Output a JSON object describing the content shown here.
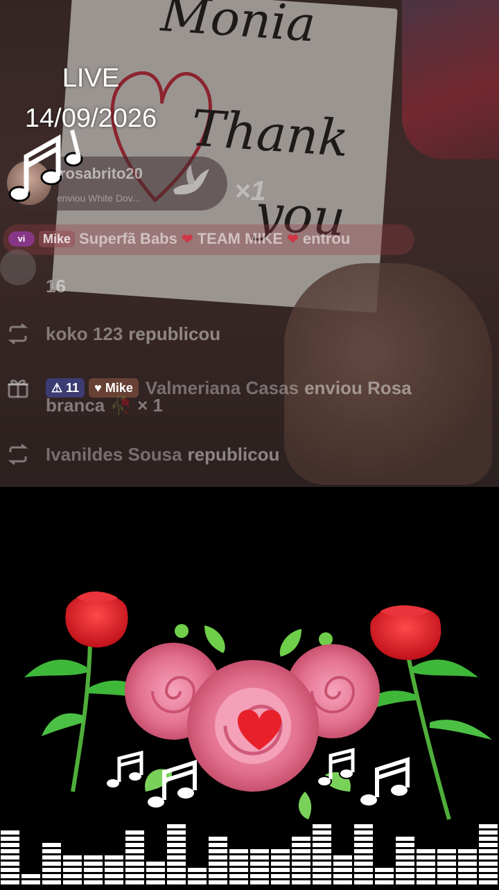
{
  "live": {
    "label": "LIVE",
    "date": "14/09/2026"
  },
  "paper": {
    "line1": "Monia",
    "line2": "Thank",
    "line3": "you"
  },
  "gift_banner": {
    "username": "rosabrito20",
    "description": "enviou White Dov...",
    "count": "×1"
  },
  "join_banner": {
    "badge_vi": "vi",
    "badge_team": "Mike",
    "text": "Superfã Babs",
    "team": "TEAM MIKE",
    "suffix": "entrou"
  },
  "comments": [
    {
      "text": "16"
    },
    {
      "name": "koko 123",
      "action": "republicou"
    },
    {
      "level": "11",
      "team": "Mike",
      "name": "Valmeriana Casas",
      "action": "enviou Rosa",
      "line2": "branca 🥀 × 1"
    },
    {
      "name": "Ivanildes Sousa",
      "action": "republicou"
    }
  ],
  "icons": [
    "music-notes-icon",
    "dove-icon",
    "repost-icon",
    "gift-icon",
    "heart-icon",
    "rose-icon"
  ],
  "colors": {
    "rose_red": "#e0202a",
    "pink_rose": "#e8789a",
    "leaf_green": "#3fb83a",
    "equalizer": "#ffffff"
  },
  "equalizer_levels": [
    0.85,
    0.25,
    0.7,
    0.55,
    0.55,
    0.55,
    0.85,
    0.4,
    0.95,
    0.35,
    0.82,
    0.65,
    0.65,
    0.65,
    0.82,
    0.95,
    0.5,
    0.95,
    0.35,
    0.82,
    0.65,
    0.65,
    0.65,
    0.95
  ]
}
